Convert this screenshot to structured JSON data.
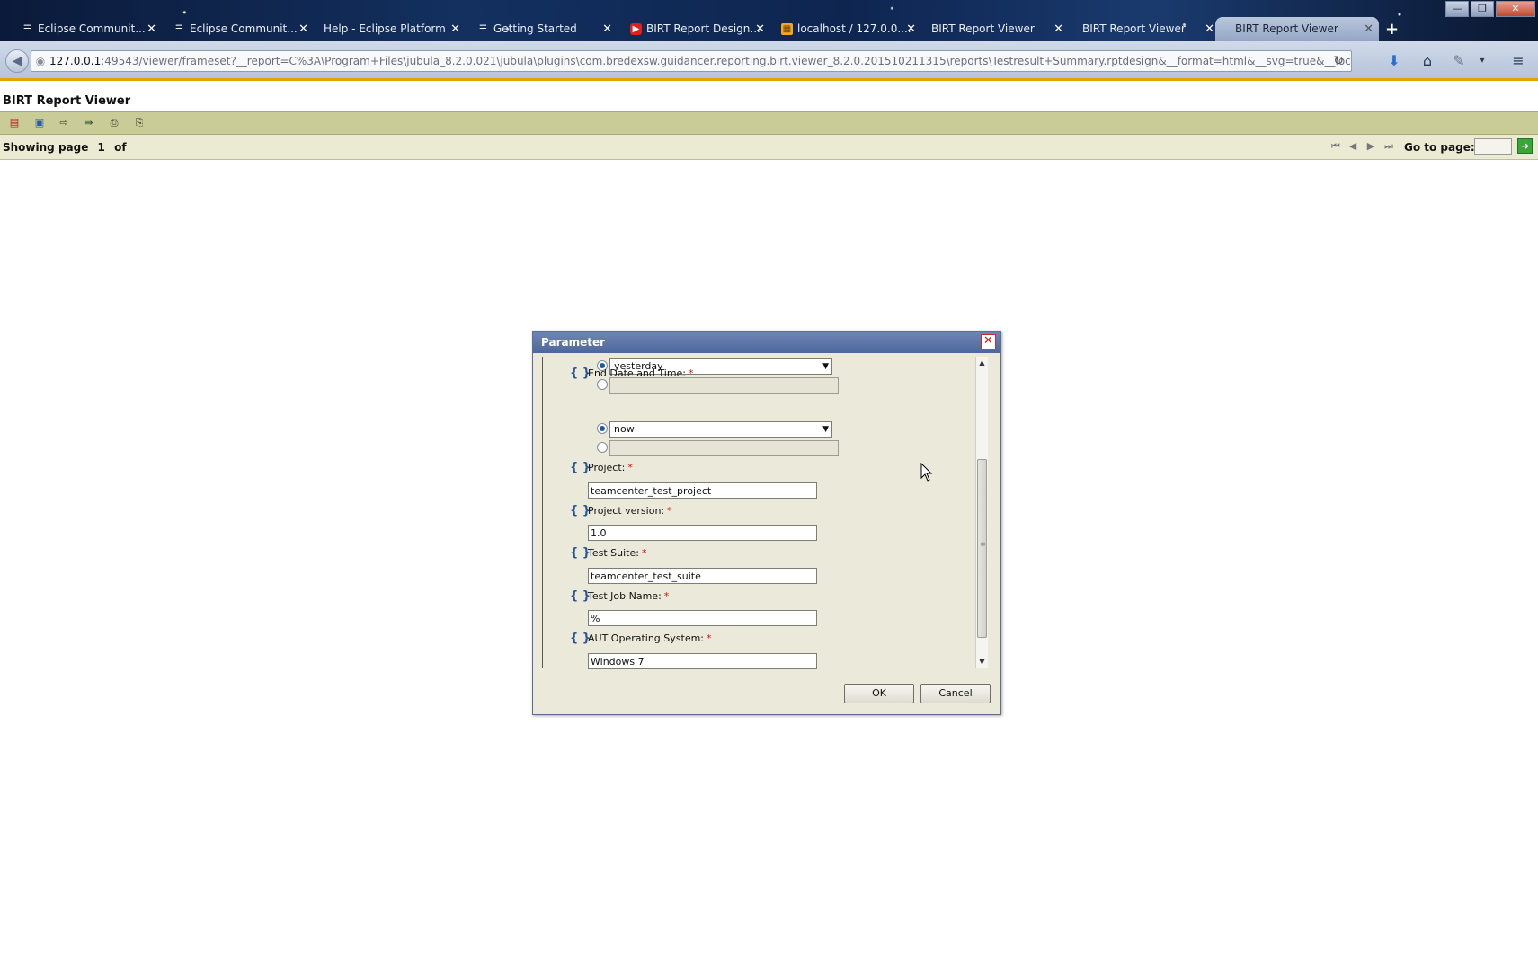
{
  "browser": {
    "tabs": [
      {
        "label": "Eclipse Communit...",
        "icon": "eclipse-icon"
      },
      {
        "label": "Eclipse Communit...",
        "icon": "eclipse-icon"
      },
      {
        "label": "Help - Eclipse Platform",
        "icon": "none"
      },
      {
        "label": "Getting Started",
        "icon": "eclipse-icon"
      },
      {
        "label": "BIRT Report Design...",
        "icon": "youtube-icon"
      },
      {
        "label": "localhost / 127.0.0....",
        "icon": "phpmyadmin-icon"
      },
      {
        "label": "BIRT Report Viewer",
        "icon": "none"
      },
      {
        "label": "BIRT Report Viewer",
        "icon": "none"
      },
      {
        "label": "BIRT Report Viewer",
        "icon": "none",
        "active": true
      }
    ],
    "new_tab": "+",
    "url_host": "127.0.0.1",
    "url_rest": ":49543/viewer/frameset?__report=C%3A\\Program+Files\\jubula_8.2.0.021\\jubula\\plugins\\com.bredexsw.guidancer.reporting.birt.viewer_8.2.0.201510211315\\reports\\Testresult+Summary.rptdesign&__format=html&__svg=true&__locale=en_US&__timezone=Po"
  },
  "viewer": {
    "title": "BIRT Report Viewer",
    "toolbar_icons": [
      "toc-icon",
      "run-report-icon",
      "export-data-icon",
      "export-report-icon",
      "print-icon",
      "print-server-icon"
    ],
    "showing_label": "Showing page",
    "page_current": "1",
    "page_of": "of",
    "goto_label": "Go to page:",
    "goto_value": ""
  },
  "dialog": {
    "title": "Parameter",
    "start_option_value": "yesterday",
    "end_label": "End Date and Time:",
    "end_option_value": "now",
    "params": [
      {
        "label": "Project:",
        "value": "teamcenter_test_project"
      },
      {
        "label": "Project version:",
        "value": "1.0"
      },
      {
        "label": "Test Suite:",
        "value": "teamcenter_test_suite"
      },
      {
        "label": "Test Job Name:",
        "value": "%"
      },
      {
        "label": "AUT Operating System:",
        "value": "Windows 7"
      }
    ],
    "required_mark": "*",
    "ok_label": "OK",
    "cancel_label": "Cancel"
  }
}
